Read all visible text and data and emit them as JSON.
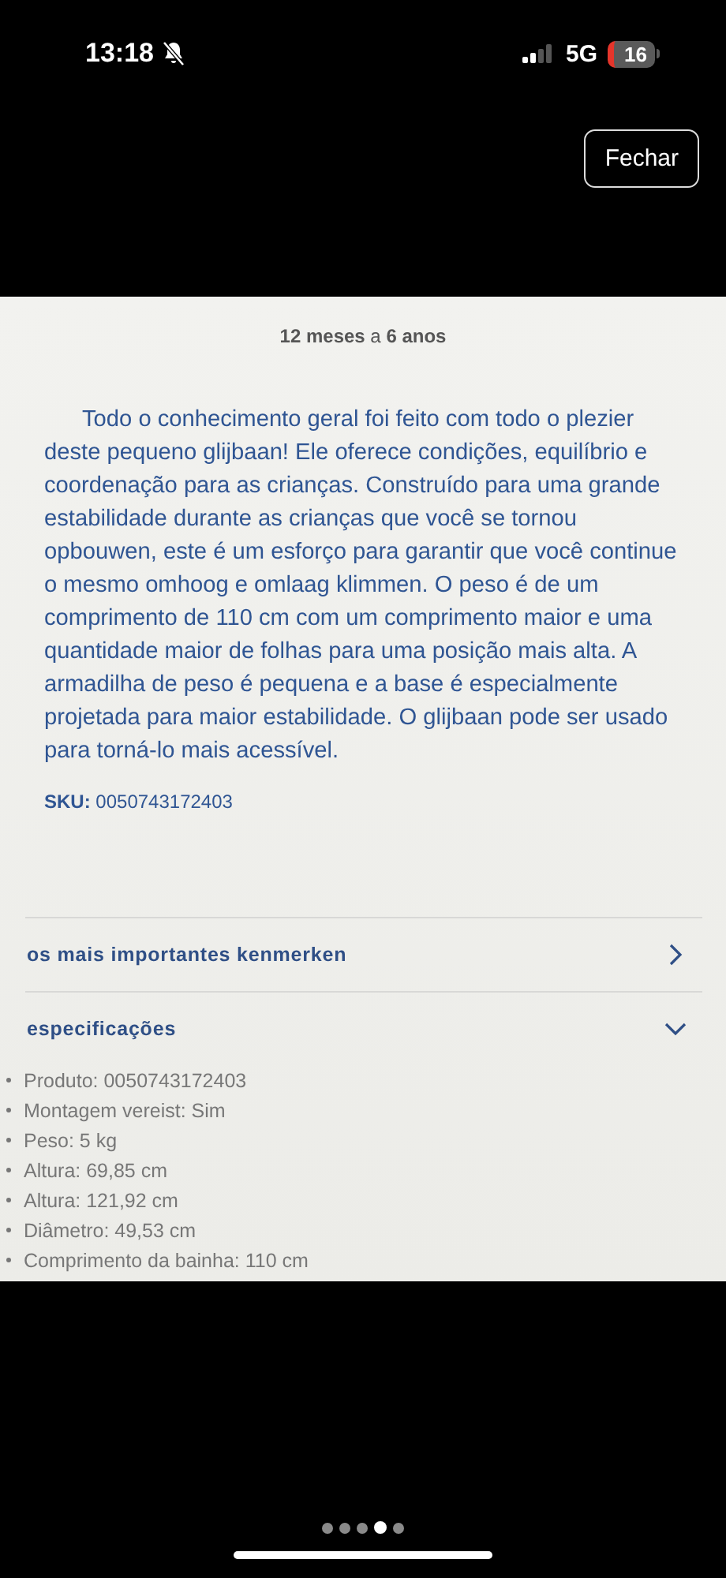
{
  "status_bar": {
    "time": "13:18",
    "network": "5G",
    "battery": "16"
  },
  "close_button": {
    "label": "Fechar"
  },
  "page": {
    "age_range": "**12 meses** a **6 anos**",
    "description": "Todo o conhecimento geral foi feito com todo o plezier deste pequeno glijbaan! Ele oferece condições, equilíbrio e coordenação para as crianças. Construído para uma grande estabilidade durante as crianças que você se tornou opbouwen, este é um esforço para garantir que você continue o mesmo omhoog e omlaag klimmen. O peso é de um comprimento de 110 cm com um comprimento maior e uma quantidade maior de folhas para uma posição mais alta. A armadilha de peso é pequena e a base é especialmente projetada para maior estabilidade. O glijbaan pode ser usado para torná-lo mais acessível.",
    "sku": "**SKU:** 0050743172403",
    "sections": [
      {
        "title": "os mais importantes kenmerken",
        "expanded": false
      },
      {
        "title": "especificações",
        "expanded": true,
        "items": [
          "Produto: 0050743172403",
          "Montagem vereist: Sim",
          "Peso: 5 kg",
          "Altura: 69,85 cm",
          "Altura: 121,92 cm",
          "Diâmetro: 49,53 cm",
          "Comprimento da bainha: 110 cm"
        ]
      }
    ]
  },
  "page_dots": [
    {
      "selected": false
    },
    {
      "selected": false
    },
    {
      "selected": false
    },
    {
      "selected": true
    },
    {
      "selected": false
    }
  ]
}
